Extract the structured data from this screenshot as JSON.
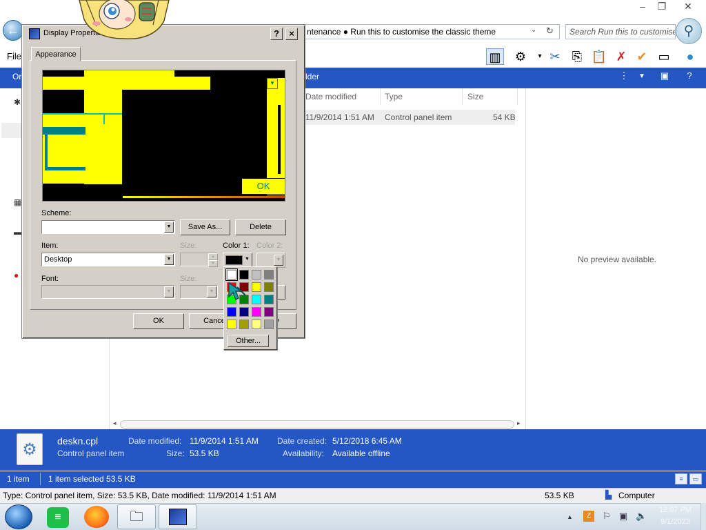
{
  "explorer": {
    "address_text": "ntenance  ●  Run this to customise the classic theme",
    "search_placeholder": "Search Run this to customise...",
    "file_menu": "File",
    "cmd_left": "Or",
    "cmd_folder": "lder",
    "columns": [
      "Date modified",
      "Type",
      "Size"
    ],
    "row": {
      "date": "11/9/2014 1:51 AM",
      "type": "Control panel item",
      "size": "54 KB"
    },
    "preview_text": "No preview available."
  },
  "details": {
    "filename": "deskn.cpl",
    "filetype": "Control panel item",
    "date_modified_label": "Date modified:",
    "date_modified": "11/9/2014 1:51 AM",
    "size_label": "Size:",
    "size": "53.5 KB",
    "date_created_label": "Date created:",
    "date_created": "5/12/2018 6:45 AM",
    "availability_label": "Availability:",
    "availability": "Available offline"
  },
  "status": {
    "item_count": "1 item",
    "selected": "1 item selected  53.5 KB"
  },
  "infobar": {
    "text": "Type: Control panel item, Size: 53.5 KB, Date modified: 11/9/2014 1:51 AM",
    "size": "53.5 KB",
    "computer": "Computer"
  },
  "taskbar": {
    "time": "12:07 PM",
    "date": "9/1/2023"
  },
  "dialog": {
    "title": "Display Properties",
    "help_btn": "?",
    "close_btn": "×",
    "tab": "Appearance",
    "preview_ok": "OK",
    "scheme_label": "Scheme:",
    "scheme_value": "",
    "save_as": "Save As...",
    "delete": "Delete",
    "item_label": "Item:",
    "item_value": "Desktop",
    "size_label": "Size:",
    "color1_label": "Color 1:",
    "color2_label": "Color 2:",
    "font_label": "Font:",
    "font_size_label": "Size:",
    "ok": "OK",
    "cancel": "Cance",
    "apply": "y"
  },
  "picker": {
    "other": "Other...",
    "colors": [
      "#ffffff",
      "#000000",
      "#c0c0c0",
      "#808080",
      "#ff0000",
      "#800000",
      "#ffff00",
      "#808000",
      "#00ff00",
      "#008000",
      "#00ffff",
      "#008080",
      "#0000ff",
      "#000080",
      "#ff00ff",
      "#800080",
      "#ffff00",
      "#a0a000",
      "#ffff80",
      "#a0a0a0"
    ]
  }
}
